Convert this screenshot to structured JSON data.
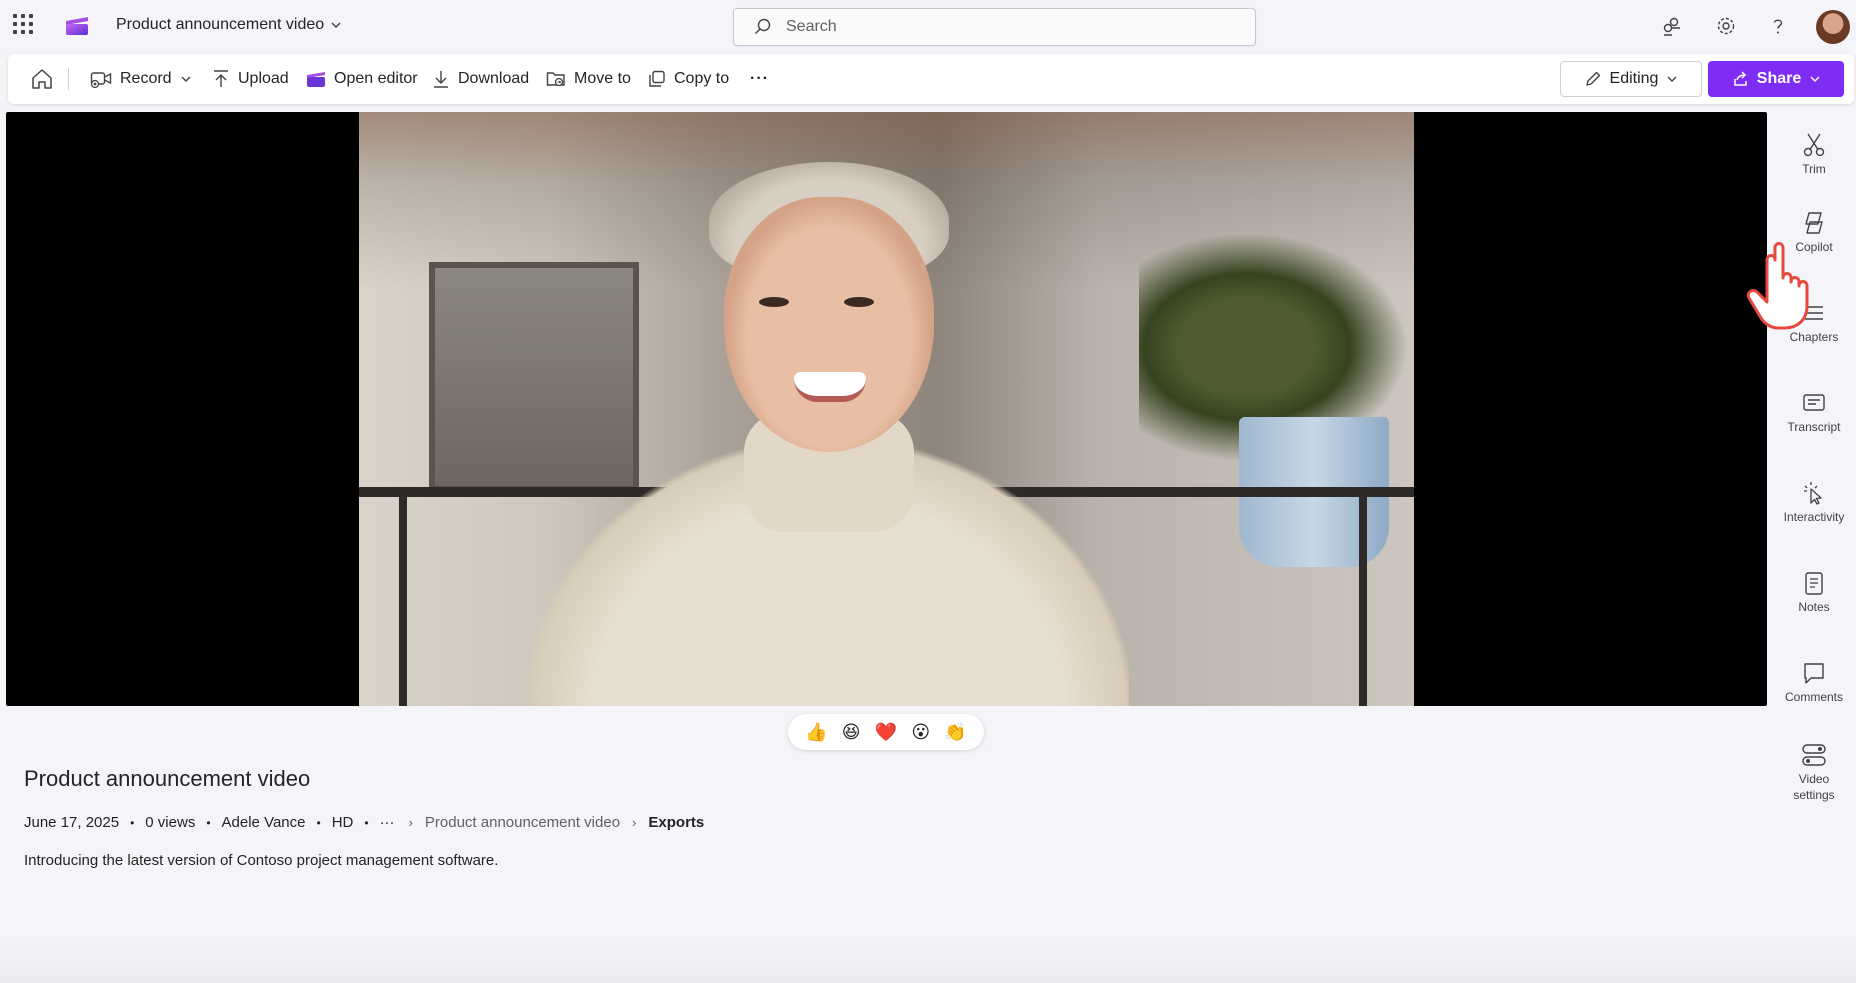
{
  "topbar": {
    "app_title": "Product announcement video",
    "search_placeholder": "Search",
    "icons": [
      "waffle-icon",
      "stream-app-icon",
      "chevron-down-icon",
      "search-icon",
      "sharepoint-sites-icon",
      "gear-icon",
      "help-icon"
    ]
  },
  "commandbar": {
    "home_icon": "home-icon",
    "record": "Record",
    "upload": "Upload",
    "open_editor": "Open editor",
    "download": "Download",
    "move_to": "Move to",
    "copy_to": "Copy to",
    "more": "···",
    "editing": "Editing",
    "share": "Share",
    "share_color": "#7f2df5"
  },
  "reactions": [
    "👍",
    "😆",
    "❤️",
    "😮",
    "👏"
  ],
  "details": {
    "title": "Product announcement video",
    "date": "June 17, 2025",
    "views": "0 views",
    "author": "Adele Vance",
    "quality": "HD",
    "ellipsis": "···",
    "breadcrumb_parent": "Product announcement video",
    "breadcrumb_current": "Exports",
    "description": "Introducing the latest version of Contoso project management software."
  },
  "rail": {
    "trim": "Trim",
    "copilot": "Copilot",
    "chapters": "Chapters",
    "transcript": "Transcript",
    "interactivity": "Interactivity",
    "notes": "Notes",
    "comments": "Comments",
    "video_settings_line1": "Video",
    "video_settings_line2": "settings"
  }
}
